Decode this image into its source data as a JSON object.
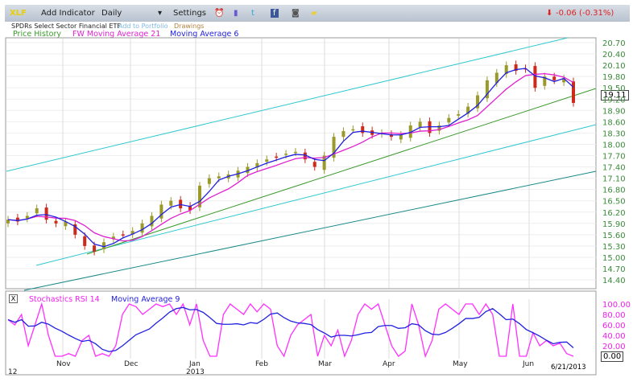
{
  "toolbar": {
    "symbol": "XLF",
    "add_indicator": "Add Indicator",
    "interval": "Daily",
    "settings": "Settings",
    "change": "-0.06 (-0.31%)",
    "icons": [
      "alarm-clock-icon",
      "book-icon",
      "twitter-icon",
      "facebook-icon",
      "camera-icon",
      "note-icon"
    ]
  },
  "subheader": {
    "name": "SPDRs Select Sector Financial ETF",
    "add_portfolio": "Add to Portfolio",
    "drawings": "Drawings"
  },
  "legend": {
    "price": "Price History",
    "ma21": "FW Moving Average 21",
    "ma6": "Moving Average 6"
  },
  "lower_legend": {
    "close": "X",
    "rsi": "Stochastics RSI 14",
    "ma9": "Moving Average 9"
  },
  "price_label": "19.11",
  "rsi_label": "0.00",
  "date_label": "6/21/2013",
  "colors": {
    "up": "#9a9a2a",
    "down": "#cc2a1a",
    "ma6": "#2020e0",
    "ma21": "#e020d0",
    "channel": "#30c8d0",
    "green": "#3a9a2a",
    "teal": "#1a8a8a",
    "rsi": "#ff30ff"
  },
  "chart_data": {
    "type": "candlestick",
    "price_ticks": [
      "20.70",
      "20.40",
      "20.10",
      "19.80",
      "19.50",
      "19.20",
      "18.90",
      "18.60",
      "18.30",
      "18.00",
      "17.70",
      "17.40",
      "17.10",
      "16.80",
      "16.50",
      "16.20",
      "15.90",
      "15.60",
      "15.30",
      "15.00",
      "14.70",
      "14.40"
    ],
    "months": [
      "Nov",
      "Dec",
      "Jan",
      "Feb",
      "Mar",
      "Apr",
      "May",
      "Jun"
    ],
    "year_labels": [
      "12",
      "2013"
    ],
    "closes": [
      16.0,
      15.95,
      16.1,
      16.3,
      16.0,
      15.9,
      15.95,
      15.6,
      15.3,
      15.15,
      15.4,
      15.55,
      15.6,
      15.7,
      15.9,
      16.1,
      16.4,
      16.5,
      16.3,
      16.25,
      16.9,
      17.1,
      17.15,
      17.2,
      17.3,
      17.4,
      17.5,
      17.6,
      17.65,
      17.75,
      17.8,
      17.6,
      17.4,
      17.7,
      18.2,
      18.35,
      18.4,
      18.3,
      18.25,
      18.3,
      18.2,
      18.25,
      18.5,
      18.6,
      18.3,
      18.5,
      18.7,
      18.8,
      19.0,
      19.3,
      19.7,
      19.9,
      20.1,
      19.95,
      20.0,
      19.5,
      19.8,
      19.7,
      19.75,
      19.1
    ],
    "rsi_ticks": [
      "100.00",
      "80.00",
      "60.00",
      "40.00",
      "20.00"
    ],
    "stoch_rsi": [
      70,
      60,
      80,
      20,
      60,
      100,
      40,
      0,
      0,
      5,
      0,
      30,
      40,
      0,
      5,
      0,
      20,
      80,
      100,
      95,
      80,
      90,
      100,
      95,
      100,
      80,
      100,
      60,
      100,
      30,
      0,
      0,
      80,
      100,
      90,
      80,
      100,
      85,
      100,
      90,
      20,
      0,
      40,
      60,
      70,
      80,
      0,
      40,
      20,
      50,
      0,
      30,
      80,
      100,
      90,
      100,
      60,
      20,
      0,
      10,
      100,
      60,
      0,
      30,
      90,
      100,
      90,
      80,
      100,
      100,
      80,
      100,
      80,
      0,
      0,
      100,
      0,
      0,
      45,
      20,
      30,
      20,
      25,
      5,
      0
    ]
  }
}
